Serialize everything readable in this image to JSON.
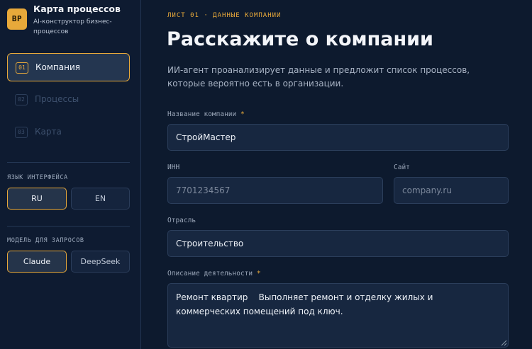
{
  "brand": {
    "logo_text": "BP",
    "title": "Карта процессов",
    "subtitle": "AI-конструктор бизнес-процессов"
  },
  "steps": [
    {
      "num": "01",
      "label": "Компания",
      "active": true
    },
    {
      "num": "02",
      "label": "Процессы",
      "active": false
    },
    {
      "num": "03",
      "label": "Карта",
      "active": false
    }
  ],
  "language": {
    "label": "ЯЗЫК ИНТЕРФЕЙСА",
    "options": [
      {
        "label": "RU",
        "active": true
      },
      {
        "label": "EN",
        "active": false
      }
    ]
  },
  "model": {
    "label": "МОДЕЛЬ ДЛЯ ЗАПРОСОВ",
    "options": [
      {
        "label": "Claude",
        "active": true
      },
      {
        "label": "DeepSeek",
        "active": false
      }
    ]
  },
  "main": {
    "kicker": "ЛИСТ 01 · ДАННЫЕ КОМПАНИИ",
    "title": "Расскажите о компании",
    "lead": "ИИ-агент проанализирует данные и предложит список процессов, которые вероятно есть в организации."
  },
  "form": {
    "company_name": {
      "label": "Название компании",
      "required_mark": "*",
      "value": "СтройМастер"
    },
    "inn": {
      "label": "ИНН",
      "placeholder": "7701234567",
      "value": ""
    },
    "site": {
      "label": "Сайт",
      "placeholder": "company.ru",
      "value": ""
    },
    "industry": {
      "label": "Отрасль",
      "value": "Строительство"
    },
    "description": {
      "label": "Описание деятельности",
      "required_mark": "*",
      "value": "Ремонт квартир    Выполняет ремонт и отделку жилых и коммерческих помещений под ключ."
    }
  },
  "colors": {
    "accent": "#e8a93a",
    "background": "#0d1a2e",
    "sidebar": "#0e1b31",
    "field": "#172740"
  }
}
